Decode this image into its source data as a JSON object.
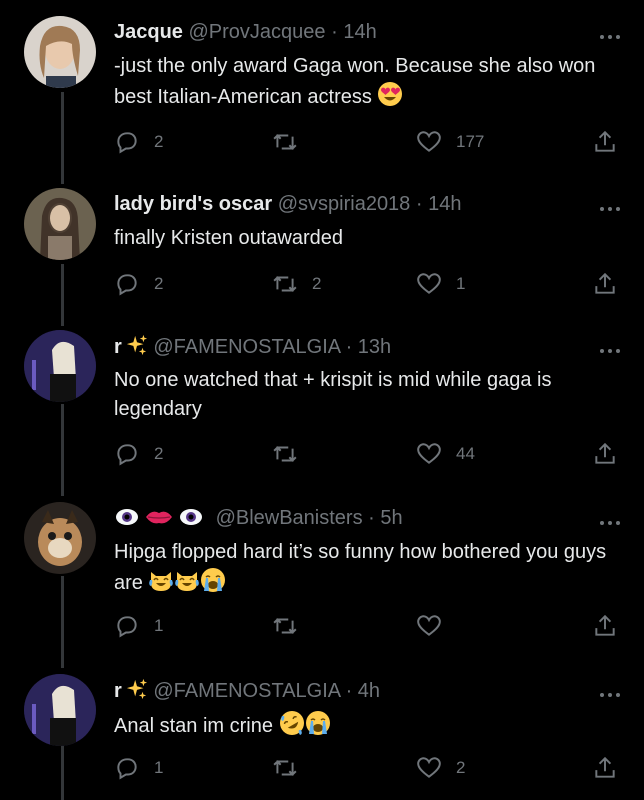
{
  "tweets": [
    {
      "name": "Jacque",
      "handle": "@ProvJacquee",
      "sep": "·",
      "time": "14h",
      "text": "-just the only award Gaga won. Because she also won best Italian-American actress",
      "emojis": [
        "heart-eyes"
      ],
      "replies": "2",
      "retweets": "",
      "likes": "177"
    },
    {
      "name": "lady bird's oscar",
      "handle": "@svspiria2018",
      "sep": "·",
      "time": "14h",
      "text": "finally Kristen outawarded",
      "emojis": [],
      "replies": "2",
      "retweets": "2",
      "likes": "1"
    },
    {
      "name": "r",
      "name_emoji": "sparkles",
      "handle": "@FAMENOSTALGIA",
      "sep": "·",
      "time": "13h",
      "text": "No one watched that + krispit is mid while gaga is legendary",
      "emojis": [],
      "replies": "2",
      "retweets": "",
      "likes": "44"
    },
    {
      "name": "",
      "name_emoji": "eye-lips-eye",
      "handle": "@BlewBanisters",
      "sep": "·",
      "time": "5h",
      "text": "Hipga flopped hard it’s so funny how bothered you guys are",
      "emojis": [
        "cat-tears-of-joy",
        "cat-tears-of-joy",
        "loudly-crying"
      ],
      "replies": "1",
      "retweets": "",
      "likes": ""
    },
    {
      "name": "r",
      "name_emoji": "sparkles",
      "handle": "@FAMENOSTALGIA",
      "sep": "·",
      "time": "4h",
      "text": "Anal stan im crine",
      "emojis": [
        "rolling-laughing",
        "loudly-crying"
      ],
      "replies": "1",
      "retweets": "",
      "likes": "2"
    }
  ],
  "colors": {
    "background": "#000000",
    "text": "#e7e9ea",
    "muted": "#71767b",
    "thread": "#333639"
  }
}
